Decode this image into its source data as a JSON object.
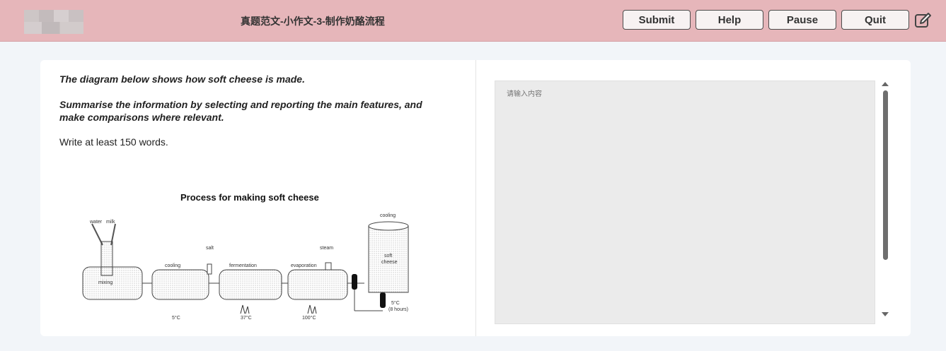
{
  "header": {
    "title": "真题范文-小作文-3-制作奶酪流程",
    "buttons": {
      "submit": "Submit",
      "help": "Help",
      "pause": "Pause",
      "quit": "Quit"
    }
  },
  "task": {
    "line1": "The diagram below shows how soft cheese is made.",
    "line2a": "Summarise the information by selecting and reporting the main features, and",
    "line2b": "make comparisons where relevant.",
    "line3": "Write at least 150 words."
  },
  "diagram": {
    "title": "Process for making soft cheese",
    "labels": {
      "water": "water",
      "milk": "milk",
      "mixing": "mixing",
      "cooling": "cooling",
      "salt": "salt",
      "fermentation": "fermentation",
      "evaporation": "evaporation",
      "steam": "steam",
      "cooling_top": "cooling",
      "soft": "soft",
      "cheese": "cheese",
      "t1": "5°C",
      "t2": "37°C",
      "t3": "100°C",
      "t4": "5°C",
      "t4b": "(8 hours)"
    }
  },
  "answer": {
    "placeholder": "请输入内容"
  },
  "colors": {
    "header_bg": "#e6b6ba",
    "page_bg": "#f2f5f9",
    "answer_bg": "#ebebeb"
  }
}
